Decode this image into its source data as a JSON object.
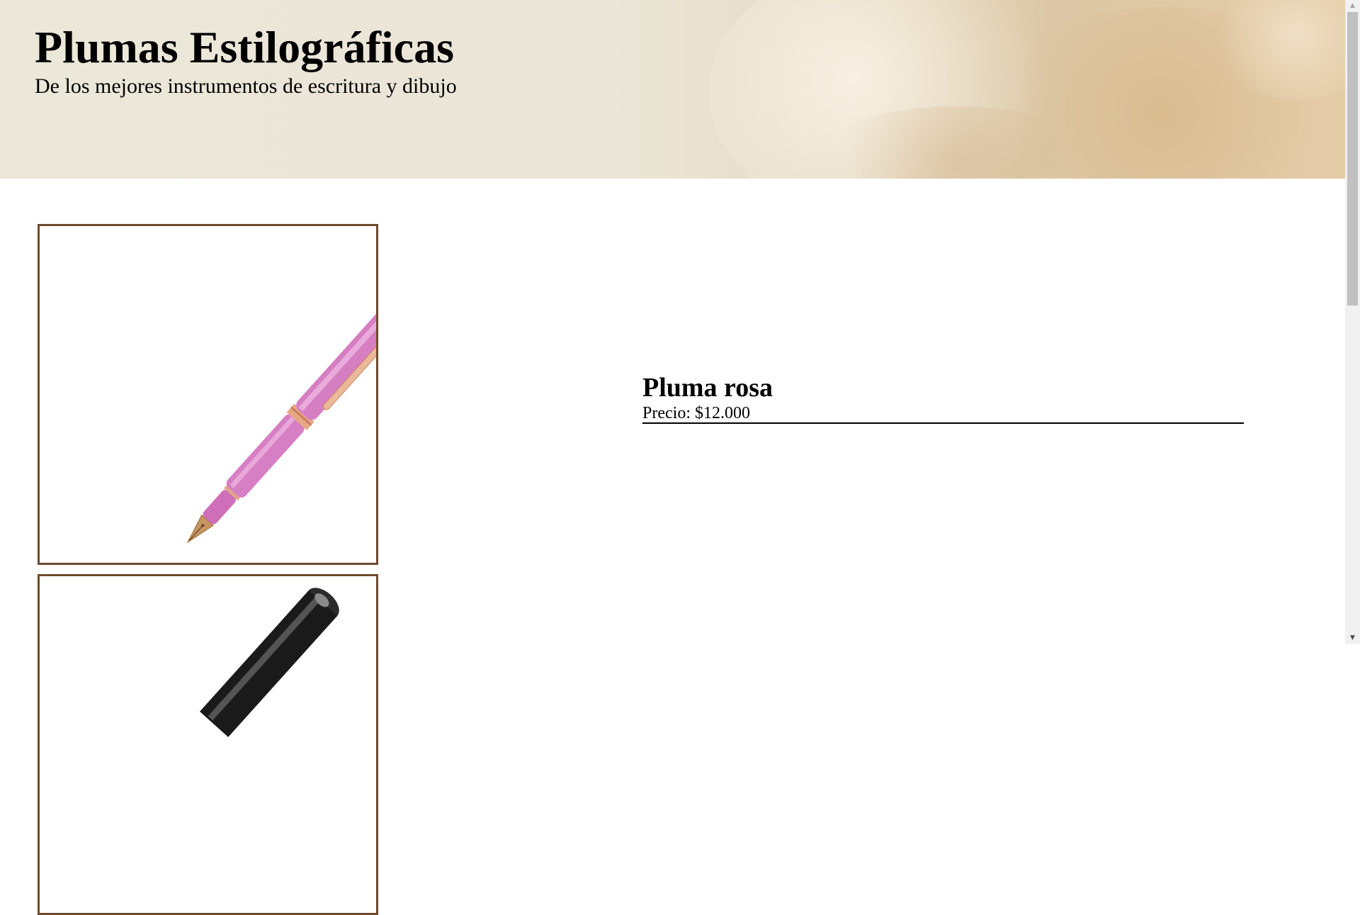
{
  "header": {
    "title": "Plumas Estilográficas",
    "subtitle": "De los mejores instrumentos de escritura y dibujo"
  },
  "products": [
    {
      "name": "Pluma rosa",
      "price": "Precio: $12.000",
      "image_icon": "pink-fountain-pen-icon"
    },
    {
      "image_icon": "black-fountain-pen-icon"
    }
  ],
  "colors": {
    "card_border": "#6e4b2d",
    "header_bg": "#ebe7d9",
    "pen_pink": "#d77fc4",
    "pen_trim": "#e8a785"
  }
}
